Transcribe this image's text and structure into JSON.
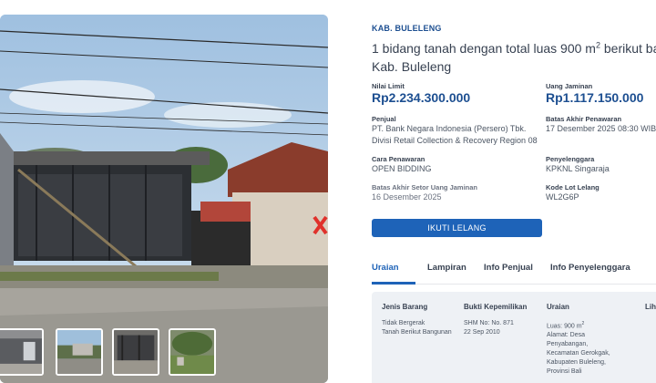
{
  "region": "KAB. BULELENG",
  "title_main": "1 bidang tanah dengan total luas 900 m",
  "title_sup": "2",
  "title_rest": " berikut ban",
  "title_line2": "Kab. Buleleng",
  "nilai_limit": {
    "label": "Nilai Limit",
    "value": "Rp2.234.300.000"
  },
  "uang_jaminan": {
    "label": "Uang Jaminan",
    "value": "Rp1.117.150.000"
  },
  "penjual": {
    "label": "Penjual",
    "line1": "PT. Bank Negara Indonesia (Persero) Tbk.",
    "line2": "Divisi Retail Collection & Recovery Region 08"
  },
  "batas_penawaran": {
    "label": "Batas Akhir Penawaran",
    "value": "17 Desember 2025 08:30 WIB"
  },
  "cara_penawaran": {
    "label": "Cara Penawaran",
    "value": "OPEN BIDDING"
  },
  "penyelenggara": {
    "label": "Penyelenggara",
    "value": "KPKNL Singaraja"
  },
  "batas_setor": {
    "label": "Batas Akhir Setor Uang Jaminan",
    "value": "16 Desember 2025"
  },
  "kode_lot": {
    "label": "Kode Lot Lelang",
    "value": "WL2G6P"
  },
  "cta_label": "IKUTI LELANG",
  "tabs": [
    "Uraian",
    "Lampiran",
    "Info Penjual",
    "Info Penyelenggara"
  ],
  "table": {
    "headers": [
      "Jenis Barang",
      "Bukti Kepemilikan",
      "Uraian",
      "Lih"
    ],
    "jenis": [
      "Tidak Bergerak",
      "Tanah Berikut Bangunan"
    ],
    "bukti": [
      "SHM No: No. 871",
      "22 Sep 2010"
    ],
    "uraian_luas": "Luas: 900 m",
    "uraian_luas_sup": "2",
    "uraian_lines": [
      "Alamat: Desa",
      "Penyabangan,",
      "Kecamatan Gerokgak,",
      "Kabupaten Buleleng,",
      "Provinsi Bali"
    ]
  },
  "colors": {
    "accent": "#1e63b8",
    "brand_text": "#1d4f91",
    "table_bg": "#eef1f5"
  }
}
